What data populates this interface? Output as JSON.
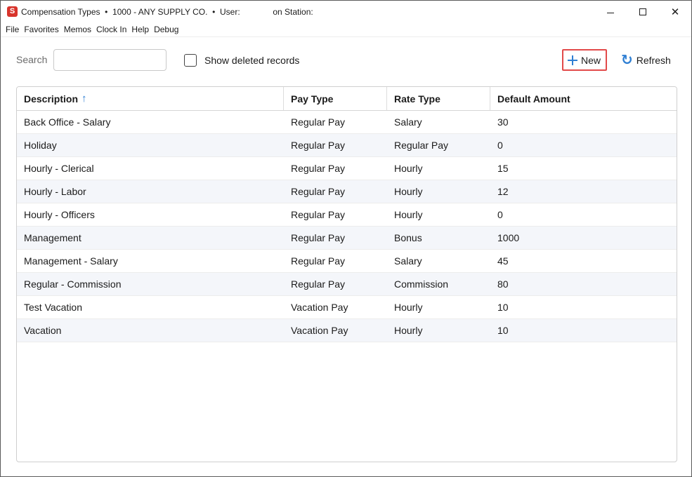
{
  "window": {
    "title": "Compensation Types  •  1000 - ANY SUPPLY CO.  •  User:              on Station:",
    "app_icon_letter": "S",
    "close_glyph": "✕"
  },
  "menu": [
    "File",
    "Favorites",
    "Memos",
    "Clock In",
    "Help",
    "Debug"
  ],
  "toolbar": {
    "search_label": "Search",
    "search_value": "",
    "show_deleted_label": "Show deleted records",
    "show_deleted_checked": false,
    "new_label": "New",
    "refresh_label": "Refresh",
    "refresh_glyph": "↻"
  },
  "grid": {
    "columns": [
      "Description",
      "Pay Type",
      "Rate Type",
      "Default Amount"
    ],
    "sort_arrow": "↑",
    "rows": [
      [
        "Back Office - Salary",
        "Regular Pay",
        "Salary",
        "30"
      ],
      [
        "Holiday",
        "Regular Pay",
        "Regular Pay",
        "0"
      ],
      [
        "Hourly - Clerical",
        "Regular Pay",
        "Hourly",
        "15"
      ],
      [
        "Hourly - Labor",
        "Regular Pay",
        "Hourly",
        "12"
      ],
      [
        "Hourly - Officers",
        "Regular Pay",
        "Hourly",
        "0"
      ],
      [
        "Management",
        "Regular Pay",
        "Bonus",
        "1000"
      ],
      [
        "Management - Salary",
        "Regular Pay",
        "Salary",
        "45"
      ],
      [
        "Regular - Commission",
        "Regular Pay",
        "Commission",
        "80"
      ],
      [
        "Test Vacation",
        "Vacation Pay",
        "Hourly",
        "10"
      ],
      [
        "Vacation",
        "Vacation Pay",
        "Hourly",
        "10"
      ]
    ]
  },
  "colors": {
    "accent": "#2f7fd3",
    "highlight_border": "#e24a4a",
    "app_icon": "#d8342c"
  }
}
